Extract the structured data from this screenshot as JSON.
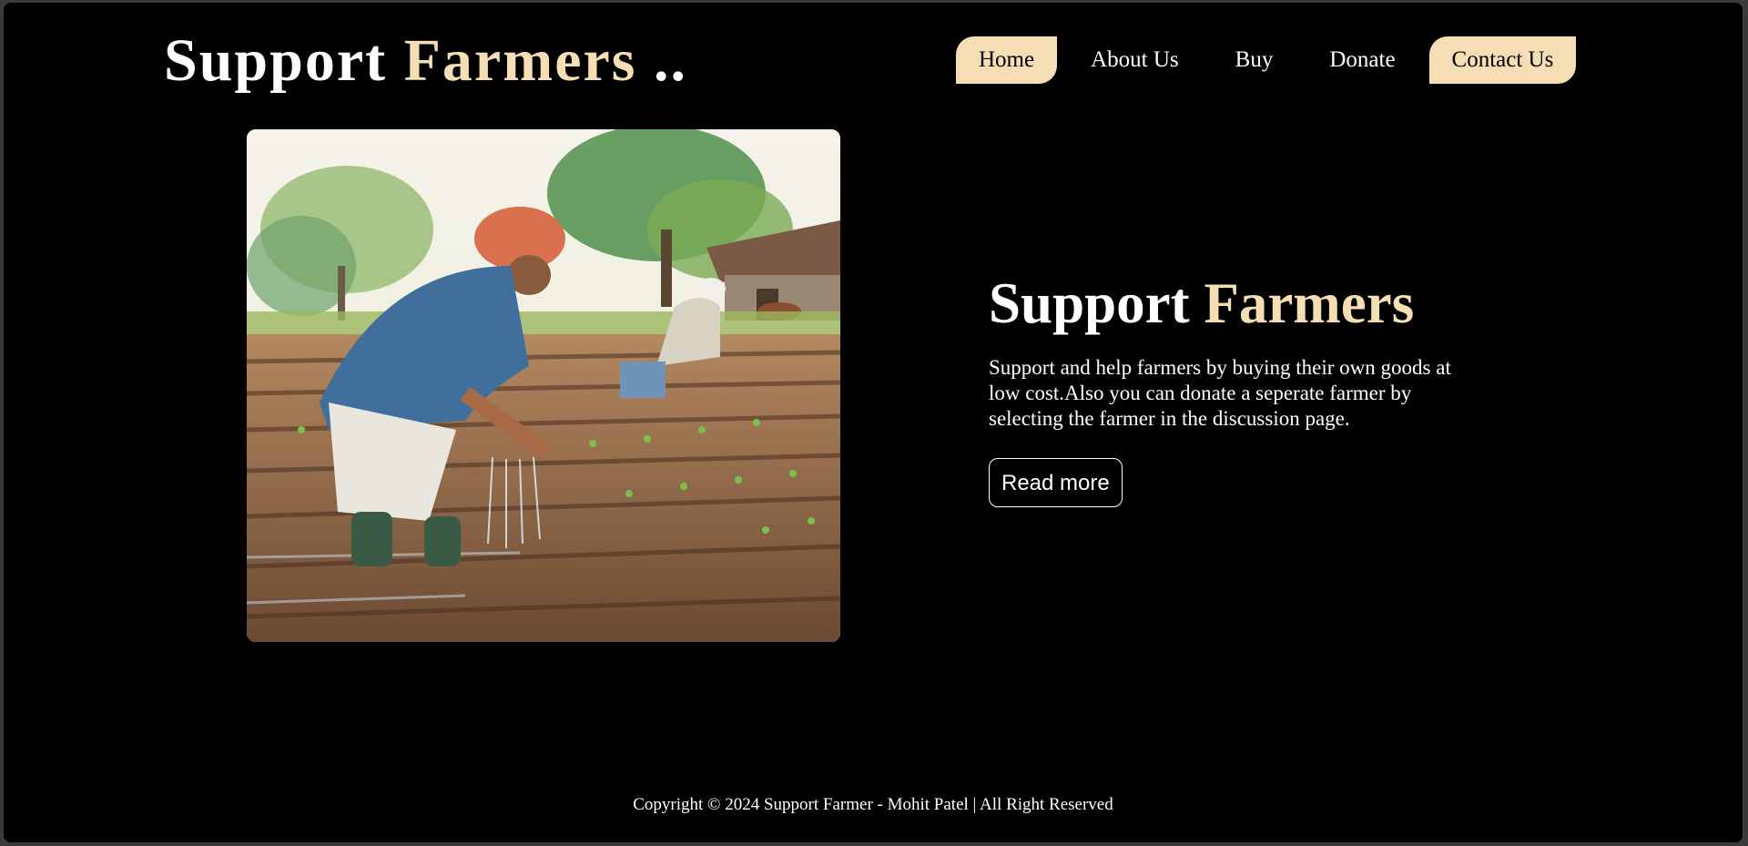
{
  "brand": {
    "word1": "Support",
    "word2": "Farmers",
    "suffix": ".."
  },
  "nav": {
    "home": "Home",
    "about": "About Us",
    "buy": "Buy",
    "donate": "Donate",
    "contact": "Contact Us"
  },
  "hero": {
    "image_icon": "farmers-in-field-illustration",
    "title_word1": "Support",
    "title_word2": "Farmers",
    "description": "Support and help farmers by buying their own goods at low cost.Also you can donate a seperate farmer by selecting the farmer in the discussion page.",
    "read_more": "Read more"
  },
  "footer": {
    "text": "Copyright © 2024 Support Farmer - Mohit Patel | All Right Reserved"
  },
  "colors": {
    "background": "#000000",
    "accent": "#f5deb3",
    "text": "#ffffff"
  }
}
